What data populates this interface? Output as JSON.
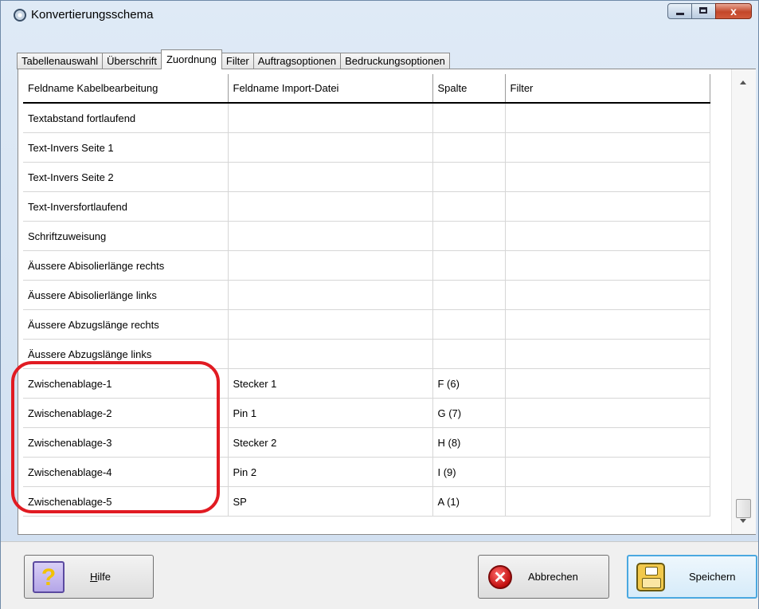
{
  "window": {
    "title": "Konvertierungsschema",
    "close_glyph": "x"
  },
  "tabs": [
    {
      "label": "Tabellenauswahl"
    },
    {
      "label": "Überschrift"
    },
    {
      "label": "Zuordnung",
      "active": true
    },
    {
      "label": "Filter"
    },
    {
      "label": "Auftragsoptionen"
    },
    {
      "label": "Bedruckungsoptionen"
    }
  ],
  "grid": {
    "columns": [
      "Feldname Kabelbearbeitung",
      "Feldname Import-Datei",
      "Spalte",
      "Filter"
    ],
    "rows": [
      [
        "Textabstand fortlaufend",
        "",
        "",
        ""
      ],
      [
        "Text-Invers Seite 1",
        "",
        "",
        ""
      ],
      [
        "Text-Invers Seite 2",
        "",
        "",
        ""
      ],
      [
        "Text-Inversfortlaufend",
        "",
        "",
        ""
      ],
      [
        "Schriftzuweisung",
        "",
        "",
        ""
      ],
      [
        "Äussere Abisolierlänge rechts",
        "",
        "",
        ""
      ],
      [
        "Äussere Abisolierlänge links",
        "",
        "",
        ""
      ],
      [
        "Äussere Abzugslänge rechts",
        "",
        "",
        ""
      ],
      [
        "Äussere Abzugslänge links",
        "",
        "",
        ""
      ],
      [
        "Zwischenablage-1",
        "Stecker 1",
        "F (6)",
        ""
      ],
      [
        "Zwischenablage-2",
        "Pin 1",
        "G (7)",
        ""
      ],
      [
        "Zwischenablage-3",
        "Stecker 2",
        "H (8)",
        ""
      ],
      [
        "Zwischenablage-4",
        "Pin 2",
        "I (9)",
        ""
      ],
      [
        "Zwischenablage-5",
        "SP",
        "A (1)",
        ""
      ]
    ]
  },
  "buttons": {
    "help": {
      "label_underlined": "H",
      "label_rest": "ilfe",
      "icon": "question-mark-icon",
      "icon_glyph": "?"
    },
    "cancel": {
      "label": "Abbrechen",
      "icon": "red-cancel-icon",
      "icon_glyph": "✕"
    },
    "save": {
      "label": "Speichern",
      "icon": "floppy-disk-icon"
    }
  },
  "colors": {
    "highlight": "#e11b22",
    "save_button_border": "#4aa8e0"
  }
}
